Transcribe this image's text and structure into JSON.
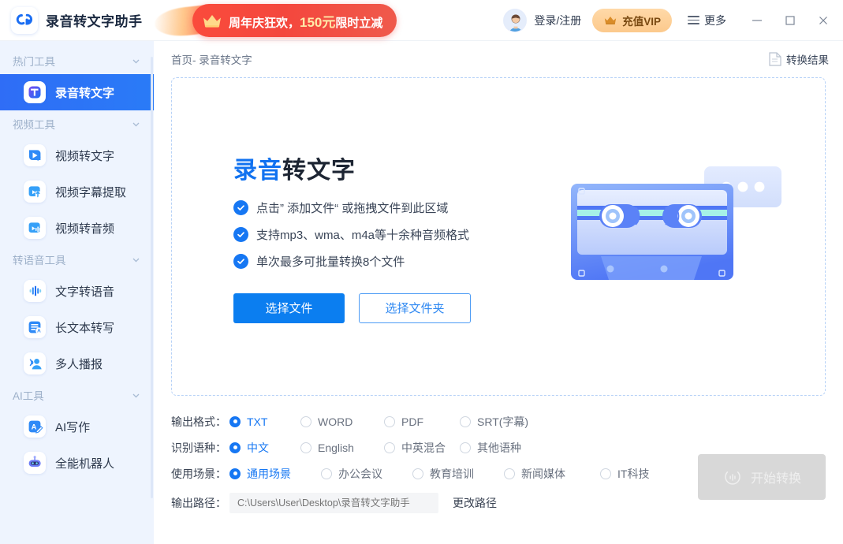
{
  "titlebar": {
    "logo_icon": "app-logo-icon",
    "brand_name": "录音转文字助手",
    "promo": {
      "icon": "crown-icon",
      "text_before": "周年庆狂欢，",
      "highlight": "150元",
      "text_after": "限时立减"
    },
    "account": {
      "avatar_icon": "user-avatar-icon",
      "label": "登录/注册"
    },
    "vip": {
      "icon": "crown-icon",
      "label": "充值VIP"
    },
    "more": {
      "icon": "hamburger-icon",
      "label": "更多"
    },
    "window_controls": {
      "minimize": "minimize-icon",
      "maximize": "maximize-icon",
      "close": "close-icon"
    }
  },
  "sidebar": {
    "groups": [
      {
        "label": "热门工具",
        "items": [
          {
            "label": "录音转文字",
            "icon": "audio-to-text-icon",
            "active": true
          }
        ]
      },
      {
        "label": "视频工具",
        "items": [
          {
            "label": "视频转文字",
            "icon": "video-to-text-icon",
            "active": false
          },
          {
            "label": "视频字幕提取",
            "icon": "video-subtitle-extract-icon",
            "active": false
          },
          {
            "label": "视频转音频",
            "icon": "video-to-audio-icon",
            "active": false
          }
        ]
      },
      {
        "label": "转语音工具",
        "items": [
          {
            "label": "文字转语音",
            "icon": "text-to-speech-icon",
            "active": false
          },
          {
            "label": "长文本转写",
            "icon": "long-text-transcribe-icon",
            "active": false
          },
          {
            "label": "多人播报",
            "icon": "multi-speaker-icon",
            "active": false
          }
        ]
      },
      {
        "label": "AI工具",
        "items": [
          {
            "label": "AI写作",
            "icon": "ai-writing-icon",
            "active": false
          },
          {
            "label": "全能机器人",
            "icon": "robot-icon",
            "active": false
          }
        ]
      }
    ]
  },
  "main": {
    "breadcrumb": {
      "home": "首页",
      "separator": "- ",
      "current": "录音转文字"
    },
    "result_link": {
      "icon": "document-icon",
      "label": "转换结果"
    },
    "dropzone": {
      "title_blue": "录音",
      "title_dark": "转文字",
      "features": [
        "点击” 添加文件“  或拖拽文件到此区域",
        "支持mp3、wma、m4a等十余种音频格式",
        "单次最多可批量转换8个文件"
      ],
      "select_file_label": "选择文件",
      "select_folder_label": "选择文件夹",
      "illustration": "cassette-tape-icon"
    }
  },
  "options": {
    "rows": [
      {
        "label": "输出格式：",
        "name": "output-format",
        "choices": [
          {
            "label": "TXT",
            "selected": true
          },
          {
            "label": "WORD",
            "selected": false
          },
          {
            "label": "PDF",
            "selected": false
          },
          {
            "label": "SRT(字幕)",
            "selected": false
          }
        ]
      },
      {
        "label": "识别语种：",
        "name": "recognize-language",
        "choices": [
          {
            "label": "中文",
            "selected": true
          },
          {
            "label": "English",
            "selected": false
          },
          {
            "label": "中英混合",
            "selected": false
          },
          {
            "label": "其他语种",
            "selected": false
          }
        ]
      },
      {
        "label": "使用场景：",
        "name": "usage-scene",
        "choices": [
          {
            "label": "通用场景",
            "selected": true
          },
          {
            "label": "办公会议",
            "selected": false
          },
          {
            "label": "教育培训",
            "selected": false
          },
          {
            "label": "新闻媒体",
            "selected": false
          },
          {
            "label": "IT科技",
            "selected": false
          }
        ]
      }
    ],
    "output_path": {
      "label": "输出路径：",
      "value": "",
      "placeholder": "C:\\Users\\User\\Desktop\\录音转文字助手",
      "change_label": "更改路径"
    },
    "start_button": {
      "icon": "waveform-icon",
      "label": "开始转换"
    }
  },
  "colors": {
    "accent": "#1677f3",
    "sidebar_bg": "#eef4fe",
    "active_nav": "#2f6df6",
    "promo_red": "#f4473d",
    "vip_gold": "#fcc98c",
    "disabled_gray": "#d8d8d8"
  }
}
